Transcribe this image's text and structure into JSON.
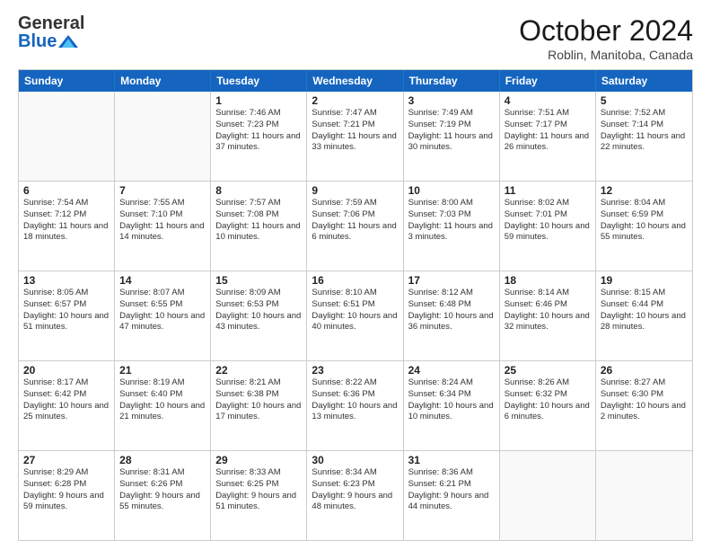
{
  "header": {
    "logo_general": "General",
    "logo_blue": "Blue",
    "month_title": "October 2024",
    "subtitle": "Roblin, Manitoba, Canada"
  },
  "days_of_week": [
    "Sunday",
    "Monday",
    "Tuesday",
    "Wednesday",
    "Thursday",
    "Friday",
    "Saturday"
  ],
  "weeks": [
    [
      {
        "day": "",
        "info": "",
        "empty": true
      },
      {
        "day": "",
        "info": "",
        "empty": true
      },
      {
        "day": "1",
        "info": "Sunrise: 7:46 AM\nSunset: 7:23 PM\nDaylight: 11 hours\nand 37 minutes."
      },
      {
        "day": "2",
        "info": "Sunrise: 7:47 AM\nSunset: 7:21 PM\nDaylight: 11 hours\nand 33 minutes."
      },
      {
        "day": "3",
        "info": "Sunrise: 7:49 AM\nSunset: 7:19 PM\nDaylight: 11 hours\nand 30 minutes."
      },
      {
        "day": "4",
        "info": "Sunrise: 7:51 AM\nSunset: 7:17 PM\nDaylight: 11 hours\nand 26 minutes."
      },
      {
        "day": "5",
        "info": "Sunrise: 7:52 AM\nSunset: 7:14 PM\nDaylight: 11 hours\nand 22 minutes."
      }
    ],
    [
      {
        "day": "6",
        "info": "Sunrise: 7:54 AM\nSunset: 7:12 PM\nDaylight: 11 hours\nand 18 minutes."
      },
      {
        "day": "7",
        "info": "Sunrise: 7:55 AM\nSunset: 7:10 PM\nDaylight: 11 hours\nand 14 minutes."
      },
      {
        "day": "8",
        "info": "Sunrise: 7:57 AM\nSunset: 7:08 PM\nDaylight: 11 hours\nand 10 minutes."
      },
      {
        "day": "9",
        "info": "Sunrise: 7:59 AM\nSunset: 7:06 PM\nDaylight: 11 hours\nand 6 minutes."
      },
      {
        "day": "10",
        "info": "Sunrise: 8:00 AM\nSunset: 7:03 PM\nDaylight: 11 hours\nand 3 minutes."
      },
      {
        "day": "11",
        "info": "Sunrise: 8:02 AM\nSunset: 7:01 PM\nDaylight: 10 hours\nand 59 minutes."
      },
      {
        "day": "12",
        "info": "Sunrise: 8:04 AM\nSunset: 6:59 PM\nDaylight: 10 hours\nand 55 minutes."
      }
    ],
    [
      {
        "day": "13",
        "info": "Sunrise: 8:05 AM\nSunset: 6:57 PM\nDaylight: 10 hours\nand 51 minutes."
      },
      {
        "day": "14",
        "info": "Sunrise: 8:07 AM\nSunset: 6:55 PM\nDaylight: 10 hours\nand 47 minutes."
      },
      {
        "day": "15",
        "info": "Sunrise: 8:09 AM\nSunset: 6:53 PM\nDaylight: 10 hours\nand 43 minutes."
      },
      {
        "day": "16",
        "info": "Sunrise: 8:10 AM\nSunset: 6:51 PM\nDaylight: 10 hours\nand 40 minutes."
      },
      {
        "day": "17",
        "info": "Sunrise: 8:12 AM\nSunset: 6:48 PM\nDaylight: 10 hours\nand 36 minutes."
      },
      {
        "day": "18",
        "info": "Sunrise: 8:14 AM\nSunset: 6:46 PM\nDaylight: 10 hours\nand 32 minutes."
      },
      {
        "day": "19",
        "info": "Sunrise: 8:15 AM\nSunset: 6:44 PM\nDaylight: 10 hours\nand 28 minutes."
      }
    ],
    [
      {
        "day": "20",
        "info": "Sunrise: 8:17 AM\nSunset: 6:42 PM\nDaylight: 10 hours\nand 25 minutes."
      },
      {
        "day": "21",
        "info": "Sunrise: 8:19 AM\nSunset: 6:40 PM\nDaylight: 10 hours\nand 21 minutes."
      },
      {
        "day": "22",
        "info": "Sunrise: 8:21 AM\nSunset: 6:38 PM\nDaylight: 10 hours\nand 17 minutes."
      },
      {
        "day": "23",
        "info": "Sunrise: 8:22 AM\nSunset: 6:36 PM\nDaylight: 10 hours\nand 13 minutes."
      },
      {
        "day": "24",
        "info": "Sunrise: 8:24 AM\nSunset: 6:34 PM\nDaylight: 10 hours\nand 10 minutes."
      },
      {
        "day": "25",
        "info": "Sunrise: 8:26 AM\nSunset: 6:32 PM\nDaylight: 10 hours\nand 6 minutes."
      },
      {
        "day": "26",
        "info": "Sunrise: 8:27 AM\nSunset: 6:30 PM\nDaylight: 10 hours\nand 2 minutes."
      }
    ],
    [
      {
        "day": "27",
        "info": "Sunrise: 8:29 AM\nSunset: 6:28 PM\nDaylight: 9 hours\nand 59 minutes."
      },
      {
        "day": "28",
        "info": "Sunrise: 8:31 AM\nSunset: 6:26 PM\nDaylight: 9 hours\nand 55 minutes."
      },
      {
        "day": "29",
        "info": "Sunrise: 8:33 AM\nSunset: 6:25 PM\nDaylight: 9 hours\nand 51 minutes."
      },
      {
        "day": "30",
        "info": "Sunrise: 8:34 AM\nSunset: 6:23 PM\nDaylight: 9 hours\nand 48 minutes."
      },
      {
        "day": "31",
        "info": "Sunrise: 8:36 AM\nSunset: 6:21 PM\nDaylight: 9 hours\nand 44 minutes."
      },
      {
        "day": "",
        "info": "",
        "empty": true
      },
      {
        "day": "",
        "info": "",
        "empty": true
      }
    ]
  ]
}
